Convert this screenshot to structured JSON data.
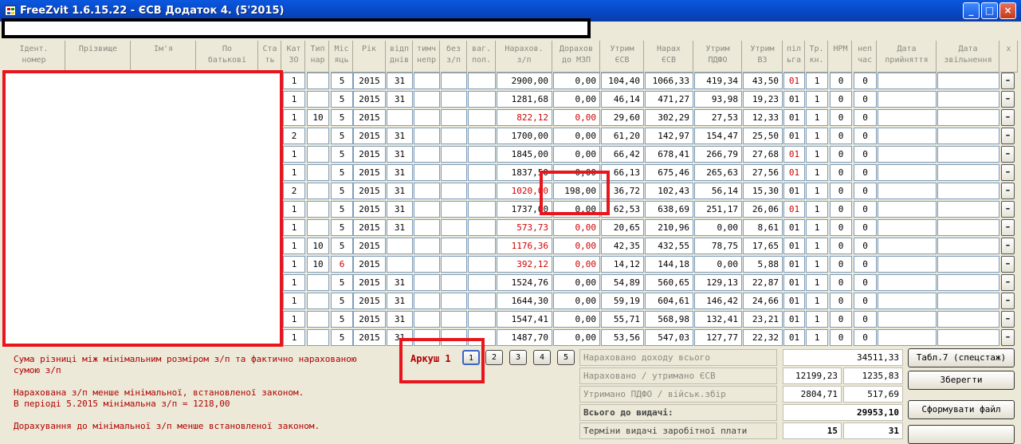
{
  "window": {
    "title": "FreeZvit 1.6.15.22 - ЄСВ Додаток 4. (5'2015)",
    "min": "_",
    "max": "□",
    "close": "×"
  },
  "headers": [
    "Ідент.\nномер",
    "Прізвище",
    "Ім'я",
    "По\nбатькові",
    "Ста\nть",
    "Кат\nЗО",
    "Тип\nнар",
    "Міс\nяць",
    "Рік",
    "відп\nднів",
    "тимч\nнепр",
    "без\nз/п",
    "ваг.\nпол.",
    "Нарахов.\nз/п",
    "Дорахов\nдо МЗП",
    "Утрим\nЄСВ",
    "Нарах\nЄСВ",
    "Утрим\nПДФО",
    "Утрим\nВЗ",
    "піл\nьга",
    "Тр.\nкн.",
    "НРМ",
    "неп\nчас",
    "Дата\nприйняття",
    "Дата\nзвільнення",
    "x"
  ],
  "rows": [
    [
      "1",
      "",
      "5",
      "2015",
      "31",
      "2900,00",
      "0,00",
      "104,40",
      "1066,33",
      "419,34",
      "43,50",
      "01",
      "1",
      "0",
      "0"
    ],
    [
      "1",
      "",
      "5",
      "2015",
      "31",
      "1281,68",
      "0,00",
      "46,14",
      "471,27",
      "93,98",
      "19,23",
      "01",
      "1",
      "0",
      "0"
    ],
    [
      "1",
      "10",
      "5",
      "2015",
      "",
      "822,12",
      "0,00",
      "29,60",
      "302,29",
      "27,53",
      "12,33",
      "01",
      "1",
      "0",
      "0"
    ],
    [
      "2",
      "",
      "5",
      "2015",
      "31",
      "1700,00",
      "0,00",
      "61,20",
      "142,97",
      "154,47",
      "25,50",
      "01",
      "1",
      "0",
      "0"
    ],
    [
      "1",
      "",
      "5",
      "2015",
      "31",
      "1845,00",
      "0,00",
      "66,42",
      "678,41",
      "266,79",
      "27,68",
      "01",
      "1",
      "0",
      "0"
    ],
    [
      "1",
      "",
      "5",
      "2015",
      "31",
      "1837,50",
      "0,00",
      "66,13",
      "675,46",
      "265,63",
      "27,56",
      "01",
      "1",
      "0",
      "0"
    ],
    [
      "2",
      "",
      "5",
      "2015",
      "31",
      "1020,00",
      "198,00",
      "36,72",
      "102,43",
      "56,14",
      "15,30",
      "01",
      "1",
      "0",
      "0"
    ],
    [
      "1",
      "",
      "5",
      "2015",
      "31",
      "1737,00",
      "0,00",
      "62,53",
      "638,69",
      "251,17",
      "26,06",
      "01",
      "1",
      "0",
      "0"
    ],
    [
      "1",
      "",
      "5",
      "2015",
      "31",
      "573,73",
      "0,00",
      "20,65",
      "210,96",
      "0,00",
      "8,61",
      "01",
      "1",
      "0",
      "0"
    ],
    [
      "1",
      "10",
      "5",
      "2015",
      "",
      "1176,36",
      "0,00",
      "42,35",
      "432,55",
      "78,75",
      "17,65",
      "01",
      "1",
      "0",
      "0"
    ],
    [
      "1",
      "10",
      "6",
      "2015",
      "",
      "392,12",
      "0,00",
      "14,12",
      "144,18",
      "0,00",
      "5,88",
      "01",
      "1",
      "0",
      "0"
    ],
    [
      "1",
      "",
      "5",
      "2015",
      "31",
      "1524,76",
      "0,00",
      "54,89",
      "560,65",
      "129,13",
      "22,87",
      "01",
      "1",
      "0",
      "0"
    ],
    [
      "1",
      "",
      "5",
      "2015",
      "31",
      "1644,30",
      "0,00",
      "59,19",
      "604,61",
      "146,42",
      "24,66",
      "01",
      "1",
      "0",
      "0"
    ],
    [
      "1",
      "",
      "5",
      "2015",
      "31",
      "1547,41",
      "0,00",
      "55,71",
      "568,98",
      "132,41",
      "23,21",
      "01",
      "1",
      "0",
      "0"
    ],
    [
      "1",
      "",
      "5",
      "2015",
      "31",
      "1487,70",
      "0,00",
      "53,56",
      "547,03",
      "127,77",
      "22,32",
      "01",
      "1",
      "0",
      "0"
    ]
  ],
  "red_cells": [
    [
      2,
      5
    ],
    [
      2,
      6
    ],
    [
      6,
      5
    ],
    [
      8,
      5
    ],
    [
      8,
      6
    ],
    [
      9,
      5
    ],
    [
      9,
      6
    ],
    [
      10,
      2
    ],
    [
      10,
      5
    ],
    [
      10,
      6
    ],
    [
      0,
      11
    ],
    [
      4,
      11
    ],
    [
      5,
      11
    ],
    [
      7,
      11
    ]
  ],
  "delete_label": "–",
  "messages": {
    "m1": "Сума різниці між мінімальним розміром з/п та фактично нарахованою\nсумою з/п",
    "m2": "Нарахована з/п менше мінімальної, встановленої законом.\nВ періоді 5.2015 мінімальна з/п = 1218,00",
    "m3": "Дорахування до мінімальної з/п менше встановленої законом."
  },
  "sheets": {
    "label": "Аркуш 1",
    "pages": [
      "1",
      "2",
      "3",
      "4",
      "5"
    ],
    "active": "1"
  },
  "summary": {
    "income_label": "Нараховано доходу всього",
    "income": "34511,33",
    "esv_label": "Нараховано / утримано ЄСВ",
    "esv_accrued": "12199,23",
    "esv_withheld": "1235,83",
    "pdfo_label": "Утримано ПДФО / військ.збір",
    "pdfo": "2804,71",
    "military": "517,69",
    "payout_label": "Всього до видачі:",
    "payout": "29953,10",
    "terms_label": "Терміни видачі заробітної плати",
    "term1": "15",
    "term2": "31"
  },
  "buttons": {
    "table7": "Табл.7 (спецстаж)",
    "save": "Зберегти",
    "generate": "Сформувати файл"
  }
}
